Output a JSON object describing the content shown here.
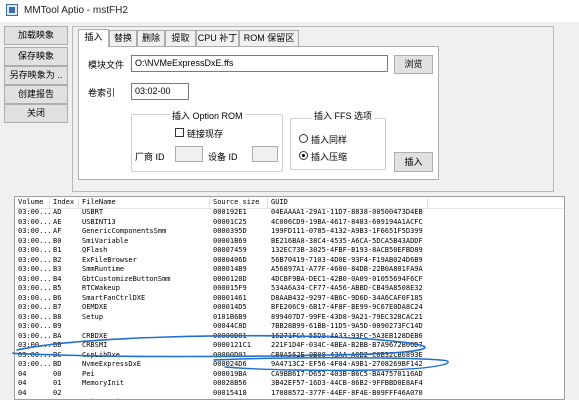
{
  "window": {
    "title": "MMTool Aptio - mstFH2"
  },
  "left_buttons": [
    {
      "label": "加载映象"
    },
    {
      "label": "保存映象"
    },
    {
      "label": "另存映象为 .."
    },
    {
      "label": "创建报告"
    },
    {
      "label": "关闭"
    }
  ],
  "tabs": [
    {
      "label": "插入",
      "active": true
    },
    {
      "label": "替换",
      "active": false
    },
    {
      "label": "删除",
      "active": false
    },
    {
      "label": "提取",
      "active": false
    },
    {
      "label": "CPU 补丁",
      "active": false
    },
    {
      "label": "ROM 保留区",
      "active": false
    }
  ],
  "insert_panel": {
    "file_label": "模块文件",
    "file_value": "O:\\NVMeExpressDxE.ffs",
    "browse_label": "浏览",
    "volume_label": "卷索引",
    "volume_value": "03:02-00",
    "option_rom": {
      "legend": "插入 Option ROM",
      "link_checkbox_label": "链接现存",
      "vendor_id_label": "厂商 ID",
      "vendor_id_value": "",
      "device_id_label": "设备 ID",
      "device_id_value": ""
    },
    "ffs_options": {
      "legend": "插入 FFS 选项",
      "options": [
        {
          "label": "插入同样",
          "selected": false
        },
        {
          "label": "插入压缩",
          "selected": true
        }
      ]
    },
    "insert_button_label": "插入"
  },
  "table": {
    "columns": [
      "Volume",
      "Index",
      "FileName",
      "Source size",
      "GUID"
    ],
    "rows": [
      [
        "03:00...",
        "AD",
        "USBRT",
        "000192E1",
        "04EAAAA1-29A1-11D7-8838-00500473D4EB"
      ],
      [
        "03:00...",
        "AE",
        "USBINT13",
        "00001C25",
        "4C006CD9-19BA-4617-8483-609194A1ACFC"
      ],
      [
        "03:00...",
        "AF",
        "GenericComponentsSmm",
        "0000395D",
        "199FD111-0785-4132-A9B3-1F6651F5D399"
      ],
      [
        "03:00...",
        "B0",
        "SmiVariable",
        "00001B69",
        "BE216BA8-38C4-4535-A6CA-5DCA5B43ADDF"
      ],
      [
        "03:00...",
        "B1",
        "QFlash",
        "00007459",
        "132EC73B-3025-4FBF-B193-8ACB50EFBD89"
      ],
      [
        "03:00...",
        "B2",
        "ExFileBrowser",
        "0000406D",
        "56B70419-7103-4D0E-93F4-F19AB024D6B9"
      ],
      [
        "03:00...",
        "B3",
        "SmmRuntime",
        "000014B9",
        "A56897A1-A77F-4600-84DB-22B0A801FA9A"
      ],
      [
        "03:00...",
        "B4",
        "GbtCustomizeButtonSmm",
        "0000128D",
        "4DCBF9BA-DEC1-42B0-0A09-01055694F6CF"
      ],
      [
        "03:00...",
        "B5",
        "RTCWakeup",
        "000015F9",
        "534A6A34-CF77-4A56-ABBD-CB49A8508E32"
      ],
      [
        "03:00...",
        "B6",
        "SmartFanCtrlDXE",
        "00001461",
        "D8AAB432-9297-4B6C-9D6D-34A6CAF0F185"
      ],
      [
        "03:00...",
        "B7",
        "OEMDXE",
        "000014D5",
        "BFE206C9-6B17-4F8F-BE99-9C67E0DA8C24"
      ],
      [
        "03:00...",
        "B8",
        "Setup",
        "0101B6B9",
        "899407D7-99FE-43D8-9A21-79EC328CAC21"
      ],
      [
        "03:00...",
        "B9",
        "",
        "00044C8D",
        "7BB28B99-61BB-11D5-9A5D-0090273FC14D"
      ],
      [
        "03:00...",
        "BA",
        "CRBDXE",
        "00000D81",
        "16271FCA-55D9-4A33-93FC-5A3EB128DEB6"
      ],
      [
        "03:00...",
        "BB",
        "CRBSMI",
        "0000121C1",
        "221F1D4F-034C-4BEA-B2BB-B7A9672B06D7"
      ],
      [
        "03:00...",
        "BC",
        "CspLibDxe",
        "00000D01",
        "CB0A562E-0B08-43AA-A0B2-C0B32CB6893E"
      ],
      [
        "03:00...",
        "BD",
        "NvmeExpressDxE",
        "000024D6",
        "9A4713C2-EF56-4F04-A9B1-2708269BF142"
      ],
      [
        "04",
        "00",
        "Pei",
        "000019BA",
        "CA9BB617-D652-403B-B6C5-BA47570116AD"
      ],
      [
        "04",
        "01",
        "MemoryInit",
        "00028B56",
        "3B42EF57-16D3-44CB-86B2-9FFBBD0E8AF4"
      ],
      [
        "04",
        "02",
        "",
        "00015418",
        "17088572-377F-44EF-8F4E-B09FFF46A070"
      ],
      [
        "04",
        "03",
        "UsbBotPeim",
        "00001B59",
        "8401A046-6F70-4505-8471-7015B40355E3"
      ],
      [
        "04",
        "04",
        "Recovery",
        "00002A39",
        "E008B434-0E73-440C-8612-A143F6A07BCB"
      ]
    ]
  }
}
